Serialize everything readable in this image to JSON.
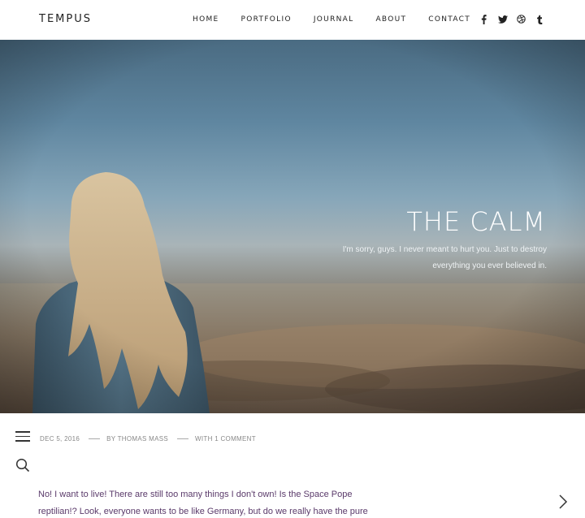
{
  "header": {
    "logo": "TEMPUS",
    "nav": [
      "HOME",
      "PORTFOLIO",
      "JOURNAL",
      "ABOUT",
      "CONTACT"
    ],
    "social": [
      "facebook-icon",
      "twitter-icon",
      "dribbble-icon",
      "tumblr-icon"
    ]
  },
  "hero": {
    "title": "THE CALM",
    "subtitle": "I'm sorry, guys. I never meant to hurt you. Just to destroy everything you ever believed in."
  },
  "post": {
    "date": "DEC 5, 2016",
    "author": "BY THOMAS MASS",
    "comments": "WITH 1 COMMENT",
    "excerpt": "No! I want to live! There are still too many things I don't own! Is the Space Pope reptilian!? Look, everyone wants to be like Germany, but do we really have the pure"
  },
  "colors": {
    "accent_text": "#5a3a6a",
    "sky_top": "#4a6b82",
    "ground": "#6e5c4c"
  }
}
